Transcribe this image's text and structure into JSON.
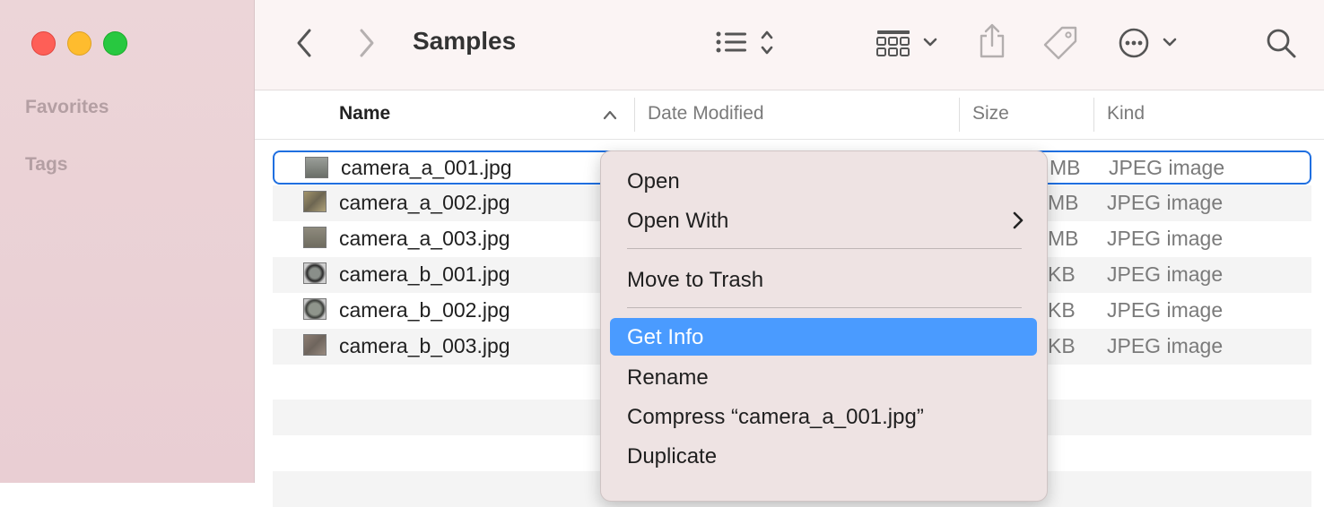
{
  "window": {
    "title": "Samples"
  },
  "sidebar": {
    "sections": [
      {
        "label": "Favorites"
      },
      {
        "label": "Tags"
      }
    ]
  },
  "toolbar": {
    "icons": [
      "back-chevron-icon",
      "forward-chevron-icon",
      "list-view-icon",
      "group-icon",
      "share-icon",
      "tag-icon",
      "more-icon",
      "search-icon"
    ]
  },
  "columns": {
    "name": "Name",
    "date_modified": "Date Modified",
    "size": "Size",
    "kind": "Kind"
  },
  "files": [
    {
      "name": "camera_a_001.jpg",
      "size": "MB",
      "kind": "JPEG image"
    },
    {
      "name": "camera_a_002.jpg",
      "size": "MB",
      "kind": "JPEG image"
    },
    {
      "name": "camera_a_003.jpg",
      "size": "MB",
      "kind": "JPEG image"
    },
    {
      "name": "camera_b_001.jpg",
      "size": "KB",
      "kind": "JPEG image"
    },
    {
      "name": "camera_b_002.jpg",
      "size": "KB",
      "kind": "JPEG image"
    },
    {
      "name": "camera_b_003.jpg",
      "size": "KB",
      "kind": "JPEG image"
    }
  ],
  "context_menu": {
    "items": [
      {
        "label": "Open"
      },
      {
        "label": "Open With"
      },
      {
        "label": "Move to Trash"
      },
      {
        "label": "Get Info"
      },
      {
        "label": "Rename"
      },
      {
        "label": "Compress “camera_a_001.jpg”"
      },
      {
        "label": "Duplicate"
      }
    ]
  },
  "colors": {
    "selection_border": "#1f6fe0",
    "menu_highlight": "#4a9bff",
    "close": "#fe5f57",
    "minimize": "#febc2e",
    "maximize": "#28c840"
  }
}
